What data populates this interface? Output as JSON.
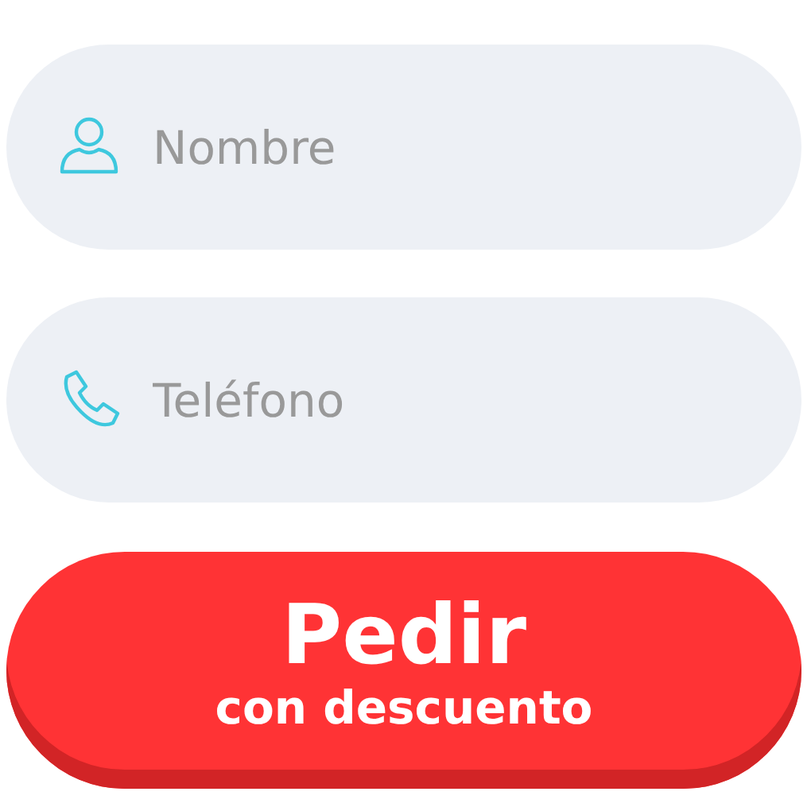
{
  "fields": [
    {
      "kind": "person",
      "placeholder": "Nombre"
    },
    {
      "kind": "phone",
      "placeholder": "Teléfono"
    }
  ],
  "button": {
    "label": "Pedir",
    "sublabel": "con descuento"
  }
}
